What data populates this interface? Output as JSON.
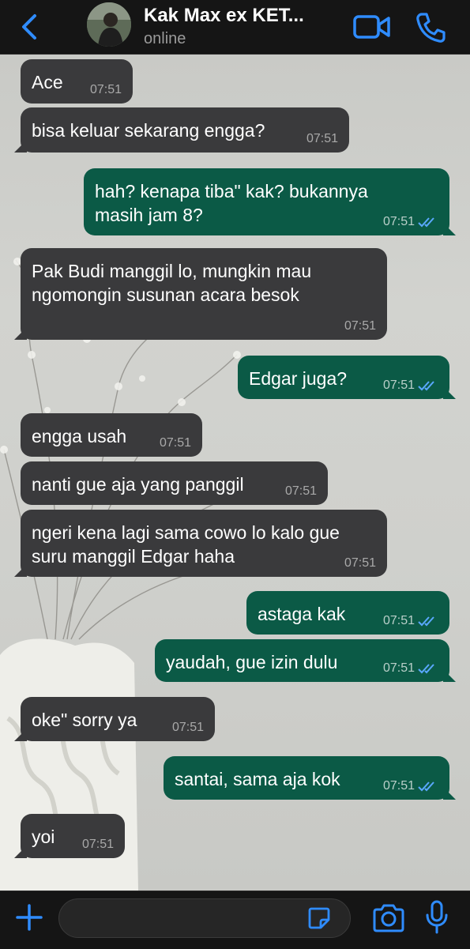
{
  "header": {
    "contact_name": "Kak Max ex KET...",
    "status": "online"
  },
  "messages": [
    {
      "dir": "in",
      "text": "Ace",
      "time": "07:51"
    },
    {
      "dir": "in",
      "text": "bisa keluar sekarang engga?",
      "time": "07:51"
    },
    {
      "dir": "out",
      "text": "hah? kenapa tiba\" kak? bukannya\nmasih jam 8?",
      "time": "07:51"
    },
    {
      "dir": "in",
      "text": "Pak Budi manggil lo, mungkin mau\nngomongin susunan acara besok",
      "time": "07:51"
    },
    {
      "dir": "out",
      "text": "Edgar juga?",
      "time": "07:51"
    },
    {
      "dir": "in",
      "text": "engga usah",
      "time": "07:51"
    },
    {
      "dir": "in",
      "text": "nanti gue aja yang panggil",
      "time": "07:51"
    },
    {
      "dir": "in",
      "text": "ngeri kena lagi sama cowo lo kalo gue\nsuru manggil Edgar haha",
      "time": "07:51"
    },
    {
      "dir": "out",
      "text": "astaga kak",
      "time": "07:51"
    },
    {
      "dir": "out",
      "text": "yaudah, gue izin dulu",
      "time": "07:51"
    },
    {
      "dir": "in",
      "text": "oke\" sorry ya",
      "time": "07:51"
    },
    {
      "dir": "out",
      "text": "santai, sama aja kok",
      "time": "07:51"
    },
    {
      "dir": "in",
      "text": "yoi",
      "time": "07:51"
    }
  ],
  "composer": {
    "placeholder": ""
  },
  "icons": {
    "back": "chevron-left-icon",
    "video": "video-camera-icon",
    "phone": "phone-icon",
    "plus": "plus-icon",
    "sticker": "sticker-icon",
    "camera": "camera-icon",
    "mic": "microphone-icon"
  },
  "colors": {
    "accent": "#2f8cff",
    "incoming_bubble": "#3a3a3c",
    "outgoing_bubble": "#0b5a46",
    "read_ticks": "#5aa8ff"
  }
}
